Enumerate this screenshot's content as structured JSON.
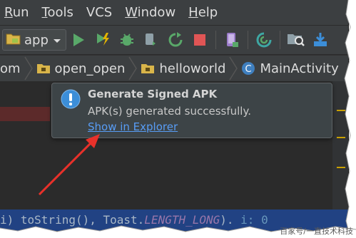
{
  "menubar": {
    "items": [
      {
        "label": "Run",
        "mnemonic": "R",
        "rest": "un"
      },
      {
        "label": "Tools",
        "mnemonic": "T",
        "rest": "ools"
      },
      {
        "label": "VCS",
        "mnemonic": "",
        "rest": "VCS"
      },
      {
        "label": "Window",
        "mnemonic": "W",
        "rest": "indow"
      },
      {
        "label": "Help",
        "mnemonic": "H",
        "rest": "elp"
      }
    ]
  },
  "toolbar": {
    "run_config": "app"
  },
  "navbar": {
    "crumbs": [
      "om",
      "open_open",
      "helloworld",
      "MainActivity"
    ]
  },
  "notification": {
    "title": "Generate Signed APK",
    "message": "APK(s) generated successfully.",
    "link": "Show in Explorer"
  },
  "editor": {
    "code_line": {
      "part1": "i) toString(), Toast.",
      "constant": "LENGTH_LONG",
      "part2": ").",
      "extra": "i: 0"
    }
  },
  "watermark": "百家号/一直技术科技",
  "colors": {
    "accent_link": "#589df6",
    "run_green": "#59a869",
    "stop_red": "#e05555",
    "arrow_red": "#e8312a"
  }
}
